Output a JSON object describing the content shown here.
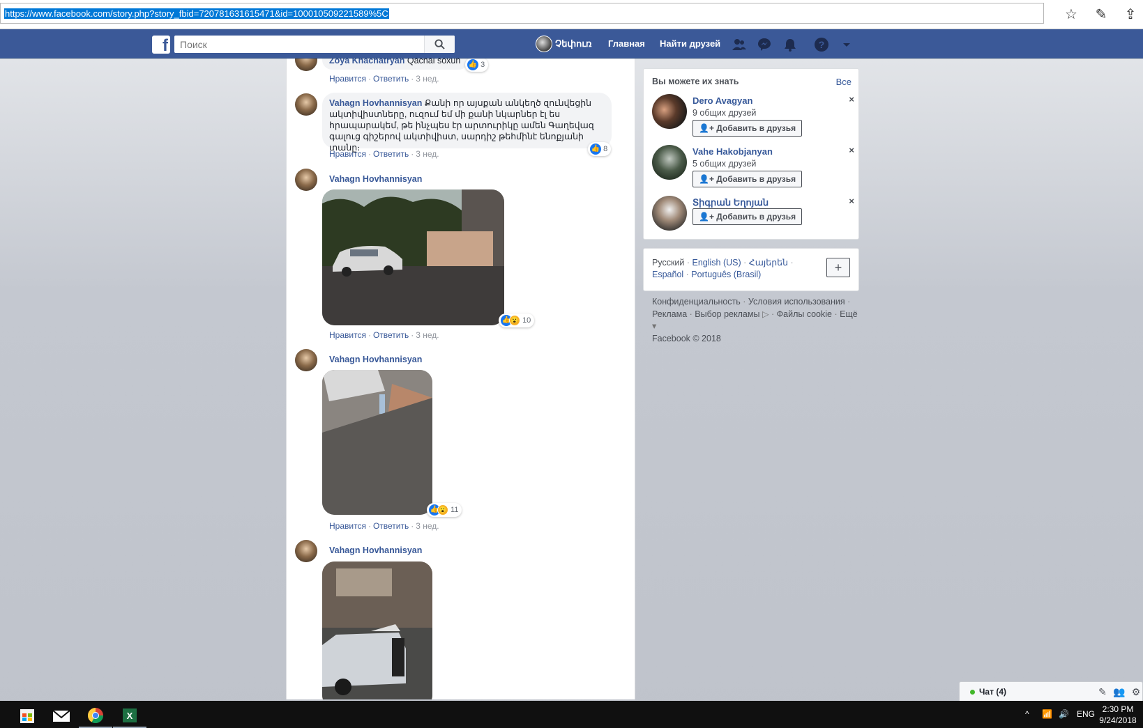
{
  "browser": {
    "url": "https://www.facebook.com/story.php?story_fbid=720781631615471&id=100010509221589%5C"
  },
  "nav": {
    "search_placeholder": "Поиск",
    "profile_name": "Չեփուռ",
    "home": "Главная",
    "find_friends": "Найти друзей",
    "brand_color": "#3b5998"
  },
  "comments": [
    {
      "author": "Zoya Khachatryan",
      "text": "Qachal soxun",
      "reactions": "3",
      "actions": {
        "like": "Нравится",
        "reply": "Ответить",
        "time": "3 нед."
      }
    },
    {
      "author": "Vahagn Hovhannisyan",
      "text": "Քանի որ այսքան անկեղծ զունվեցին ակտիվիստները, ուզում եմ մի քանի նկարներ էլ ես հրապարակեմ, թե ինչպես էր արտուրիկը ամեն Գաղեվազ գալուց գիշերով ակտիվիստ, սարդիշ թեհմինէ ենոքյանի տանը։",
      "reactions": "8",
      "actions": {
        "like": "Нравится",
        "reply": "Ответить",
        "time": "3 нед."
      }
    },
    {
      "author": "Vahagn Hovhannisyan",
      "reactions": "10",
      "actions": {
        "like": "Нравится",
        "reply": "Ответить",
        "time": "3 нед."
      }
    },
    {
      "author": "Vahagn Hovhannisyan",
      "reactions": "11",
      "actions": {
        "like": "Нравится",
        "reply": "Ответить",
        "time": "3 нед."
      }
    },
    {
      "author": "Vahagn Hovhannisyan"
    }
  ],
  "pymk": {
    "title": "Вы можете их знать",
    "see_all": "Все",
    "people": [
      {
        "name": "Dero Avagyan",
        "mutual": "9 общих друзей",
        "add_label": "Добавить в друзья"
      },
      {
        "name": "Vahe Hakobjanyan",
        "mutual": "5 общих друзей",
        "add_label": "Добавить в друзья"
      },
      {
        "name": "Տիգրան Եղոյան",
        "add_label": "Добавить в друзья"
      }
    ]
  },
  "languages": {
    "current": "Русский",
    "options": [
      "English (US)",
      "Հայերեն",
      "Español",
      "Português (Brasil)"
    ],
    "plus": "+"
  },
  "footer": {
    "links": [
      "Конфиденциальность",
      "Условия использования",
      "Реклама",
      "Выбор рекламы",
      "Файлы cookie",
      "Ещё"
    ],
    "copyright": "Facebook © 2018"
  },
  "chat": {
    "label": "Чат (4)"
  },
  "taskbar": {
    "lang": "ENG",
    "time": "2:30 PM",
    "date": "9/24/2018"
  }
}
